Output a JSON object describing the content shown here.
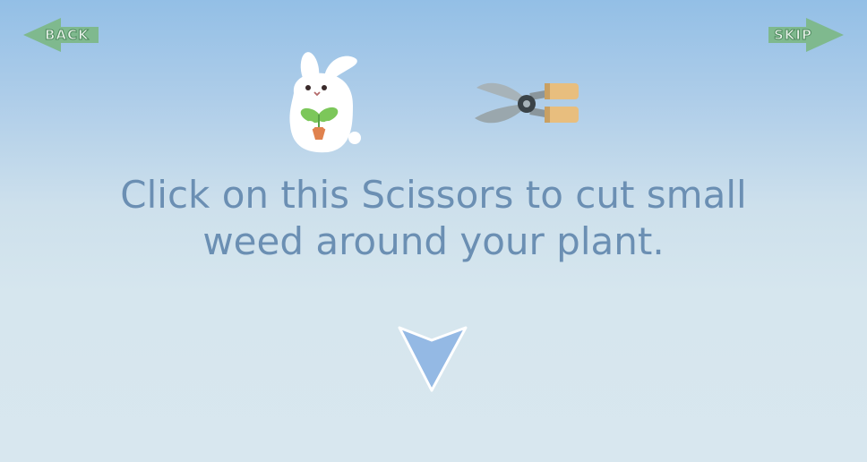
{
  "nav": {
    "back_label": "BACK",
    "skip_label": "SKIP"
  },
  "tutorial": {
    "line1": "Click on this Scissors to cut small",
    "line2": "weed around your plant."
  },
  "icons": {
    "mascot": "bunny-holding-sprout-icon",
    "tool": "pruning-scissors-icon",
    "pointer": "down-arrow-icon"
  },
  "colors": {
    "nav_green": "#7fb98e",
    "text_blue": "#6b8fb3",
    "arrow_blue": "#94b9e4"
  }
}
